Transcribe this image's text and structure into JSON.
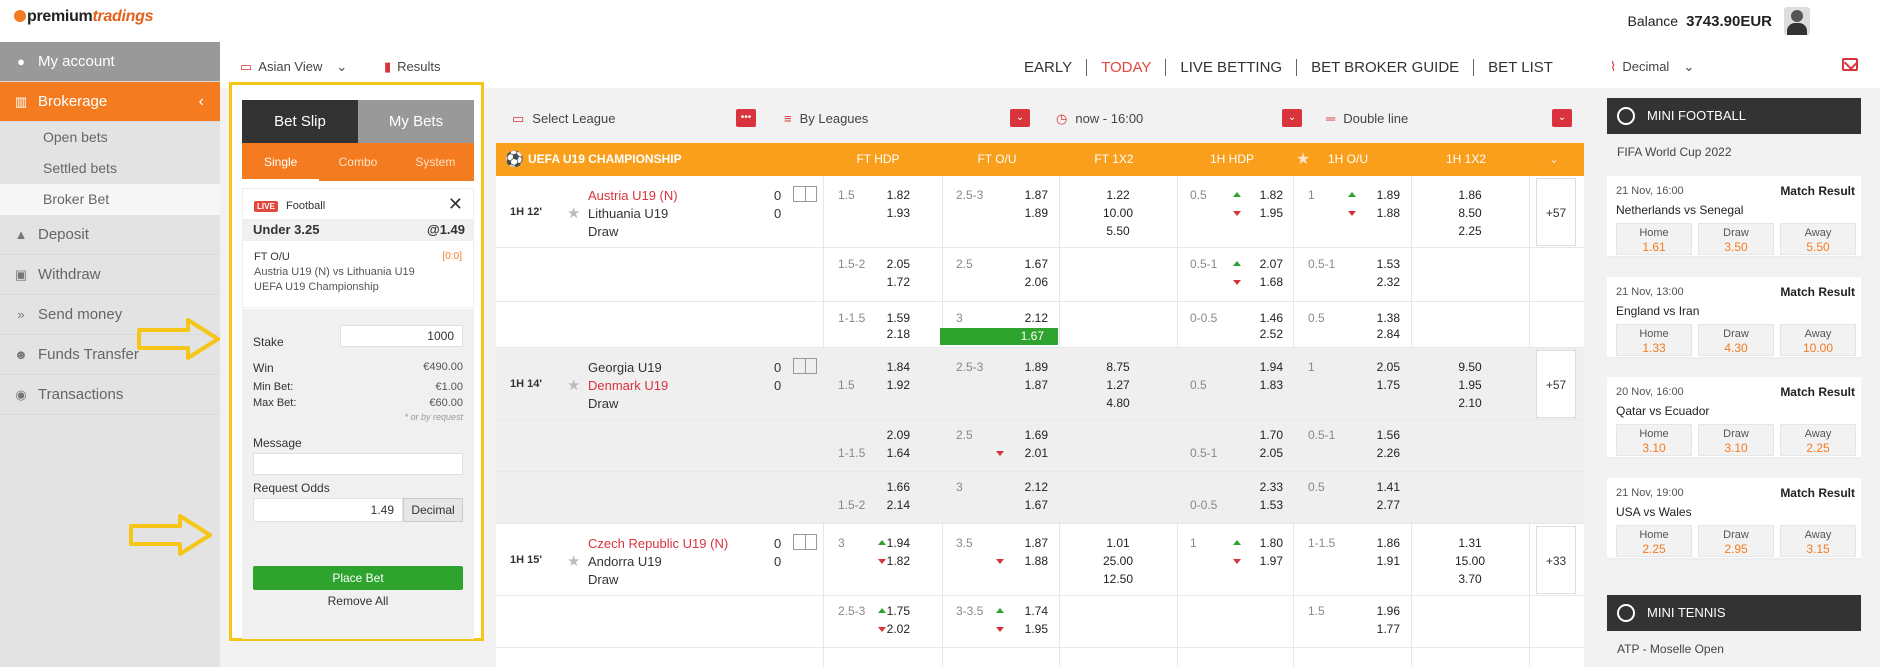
{
  "header": {
    "logo_main": "premium",
    "logo_tail": "tradings",
    "balance_label": "Balance",
    "balance_value": "3743.90EUR"
  },
  "sidebar": {
    "account": "My account",
    "brokerage": "Brokerage",
    "sub": [
      "Open bets",
      "Settled bets",
      "Broker Bet"
    ],
    "items": [
      "Deposit",
      "Withdraw",
      "Send money",
      "Funds Transfer",
      "Transactions"
    ]
  },
  "topbar": {
    "asian_view": "Asian View",
    "results": "Results",
    "nav": [
      "EARLY",
      "TODAY",
      "LIVE BETTING",
      "BET BROKER GUIDE",
      "BET LIST"
    ],
    "decimal": "Decimal"
  },
  "slip": {
    "tab_slip": "Bet Slip",
    "tab_mybets": "My Bets",
    "sub": [
      "Single",
      "Combo",
      "System"
    ],
    "live": "LIVE",
    "sport": "Football",
    "close": "✕",
    "selection": "Under  3.25",
    "odds": "@1.49",
    "market": "FT O/U",
    "score": "[0:0]",
    "event": "Austria U19 (N) vs Lithuania U19",
    "league": "UEFA U19 Championship",
    "stake_label": "Stake",
    "stake_value": "1000",
    "win_label": "Win",
    "win_value": "€490.00",
    "minbet_label": "Min Bet:",
    "minbet_value": "€1.00",
    "maxbet_label": "Max Bet:",
    "maxbet_value": "€60.00",
    "note": "* or by request",
    "message_label": "Message",
    "request_label": "Request Odds",
    "request_value": "1.49",
    "request_format": "Decimal",
    "place": "Place Bet",
    "remove": "Remove All"
  },
  "toolbar": {
    "league": "Select League",
    "sort": "By Leagues",
    "time": "now - 16:00",
    "line": "Double line"
  },
  "league": {
    "name": "UEFA U19 CHAMPIONSHIP",
    "cols": [
      "FT HDP",
      "FT O/U",
      "FT 1X2",
      "1H HDP",
      "1H O/U",
      "1H 1X2"
    ]
  },
  "matches": [
    {
      "time": "1H 12'",
      "home": "Austria U19 (N)",
      "away": "Lithuania U19",
      "draw": "Draw",
      "hs": "0",
      "as": "0",
      "more": "+57"
    },
    {
      "time": "1H 14'",
      "home": "Georgia U19",
      "away": "Denmark U19",
      "draw": "Draw",
      "hs": "0",
      "as": "0",
      "more": "+57"
    },
    {
      "time": "1H 15'",
      "home": "Czech Republic U19 (N)",
      "away": "Andorra U19",
      "draw": "Draw",
      "hs": "0",
      "as": "0",
      "more": "+33"
    }
  ],
  "odds": {
    "r1": [
      "1.5",
      "1.82",
      "1.93",
      "2.5-3",
      "1.87",
      "1.89",
      "1.22",
      "10.00",
      "5.50",
      "0.5",
      "1.82",
      "1.95",
      "1",
      "1.89",
      "1.88",
      "1.86",
      "8.50",
      "2.25"
    ],
    "r2": [
      "1.5-2",
      "2.05",
      "1.72",
      "2.5",
      "1.67",
      "2.06",
      "0.5-1",
      "2.07",
      "1.68",
      "0.5-1",
      "1.53",
      "2.32"
    ],
    "r3": [
      "1-1.5",
      "1.59",
      "2.18",
      "3",
      "2.12",
      "1.67",
      "0-0.5",
      "1.46",
      "2.52",
      "0.5",
      "1.38",
      "2.84"
    ],
    "r4": [
      "1.5",
      "1.84",
      "1.92",
      "2.5-3",
      "1.89",
      "1.87",
      "8.75",
      "1.27",
      "4.80",
      "0.5",
      "1.94",
      "1.83",
      "1",
      "2.05",
      "1.75",
      "9.50",
      "1.95",
      "2.10"
    ],
    "r5": [
      "1-1.5",
      "2.09",
      "1.64",
      "2.5",
      "1.69",
      "2.01",
      "0.5-1",
      "1.70",
      "2.05",
      "0.5-1",
      "1.56",
      "2.26"
    ],
    "r6": [
      "1.5-2",
      "1.66",
      "2.14",
      "3",
      "2.12",
      "1.67",
      "0-0.5",
      "2.33",
      "1.53",
      "0.5",
      "1.41",
      "2.77"
    ],
    "r7": [
      "3",
      "1.94",
      "1.82",
      "3.5",
      "1.87",
      "1.88",
      "1.01",
      "25.00",
      "12.50",
      "1",
      "1.80",
      "1.97",
      "1-1.5",
      "1.86",
      "1.91",
      "1.31",
      "15.00",
      "3.70"
    ],
    "r8": [
      "2.5-3",
      "1.75",
      "2.02",
      "3-3.5",
      "1.74",
      "1.95",
      "1.5",
      "1.96",
      "1.77"
    ]
  },
  "mini_football": {
    "title": "MINI FOOTBALL",
    "subtitle": "FIFA World Cup 2022",
    "matches": [
      {
        "date": "21 Nov, 16:00",
        "market": "Match Result",
        "teams": "Netherlands  vs  Senegal",
        "home": "1.61",
        "draw": "3.50",
        "away": "5.50"
      },
      {
        "date": "21 Nov, 13:00",
        "market": "Match Result",
        "teams": "England  vs  Iran",
        "home": "1.33",
        "draw": "4.30",
        "away": "10.00"
      },
      {
        "date": "20 Nov, 16:00",
        "market": "Match Result",
        "teams": "Qatar  vs  Ecuador",
        "home": "3.10",
        "draw": "3.10",
        "away": "2.25"
      },
      {
        "date": "21 Nov, 19:00",
        "market": "Match Result",
        "teams": "USA  vs  Wales",
        "home": "2.25",
        "draw": "2.95",
        "away": "3.15"
      }
    ],
    "labels": {
      "home": "Home",
      "draw": "Draw",
      "away": "Away"
    }
  },
  "mini_tennis": {
    "title": "MINI TENNIS",
    "subtitle": "ATP - Moselle Open"
  },
  "colors": {
    "accent": "#f47b20",
    "league_bar": "#f99f1b",
    "red": "#d9343d",
    "green": "#2ea32e",
    "highlight": "#f5c518"
  }
}
